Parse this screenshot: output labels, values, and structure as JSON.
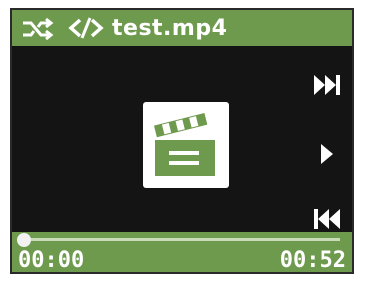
{
  "player": {
    "title": "test.mp4",
    "time_elapsed": "00:00",
    "time_total": "00:52",
    "progress": 0,
    "colors": {
      "accent": "#6e9a4e",
      "screen": "#141414",
      "icon": "#ffffff"
    },
    "icons": {
      "shuffle": "shuffle-icon",
      "repeat": "repeat-off-icon",
      "art": "clapperboard-icon",
      "next": "skip-next-icon",
      "play": "play-icon",
      "prev": "skip-previous-icon"
    }
  }
}
